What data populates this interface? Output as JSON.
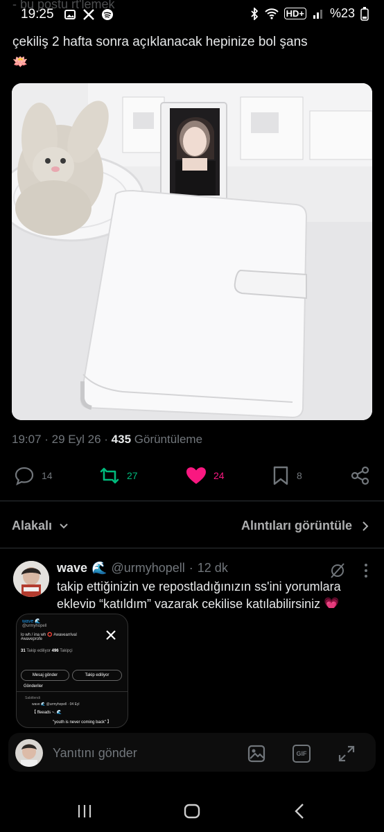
{
  "status_bar": {
    "time": "19:25",
    "ghost_text": "- bu postu rt'lemek",
    "battery": "%23"
  },
  "tweet": {
    "text": "çekiliş 2 hafta sonra açıklanacak hepinize bol şans",
    "emoji": "🪷",
    "time": "19:07",
    "date": "29 Eyl 26",
    "views": "435",
    "views_label": "Görüntüleme",
    "replies": "14",
    "reposts": "27",
    "likes": "24",
    "bookmarks": "8"
  },
  "tabs": {
    "related": "Alakalı",
    "quotes": "Alıntıları görüntüle"
  },
  "reply": {
    "name": "wave",
    "name_emoji": "🌊",
    "handle": "@urmyhopell",
    "age": "12 dk",
    "text": "takip ettiğinizin ve repostladığınızın ss'ini yorumlara ekleyip “katıldım” yazarak çekilişe katılabilirsiniz 💗"
  },
  "pip": {
    "name": "wave 🌊",
    "handle": "@urmyhopell",
    "bio": "lo wh / ina wh ⭕ #wavearrival #waveprofe",
    "following": "31",
    "following_label": "Takip ediliyor",
    "followers": "496",
    "followers_label": "Takipçi",
    "message_btn": "Mesaj gönder",
    "follow_btn": "Takip ediliyor",
    "posts_tab": "Gönderiler",
    "pinned": "Sabitlendi",
    "post_name": "wave 🌊 @urmyhopell · 04 Eyl",
    "post_text": "【 ffeeads ~. 🌊",
    "quote": "\"youth is never coming back\" 】"
  },
  "composer": {
    "placeholder": "Yanıtını gönder",
    "gif_label": "GIF"
  },
  "colors": {
    "like": "#f91880",
    "repost": "#00ba7c",
    "muted": "#71767b",
    "text": "#e7e9ea"
  }
}
